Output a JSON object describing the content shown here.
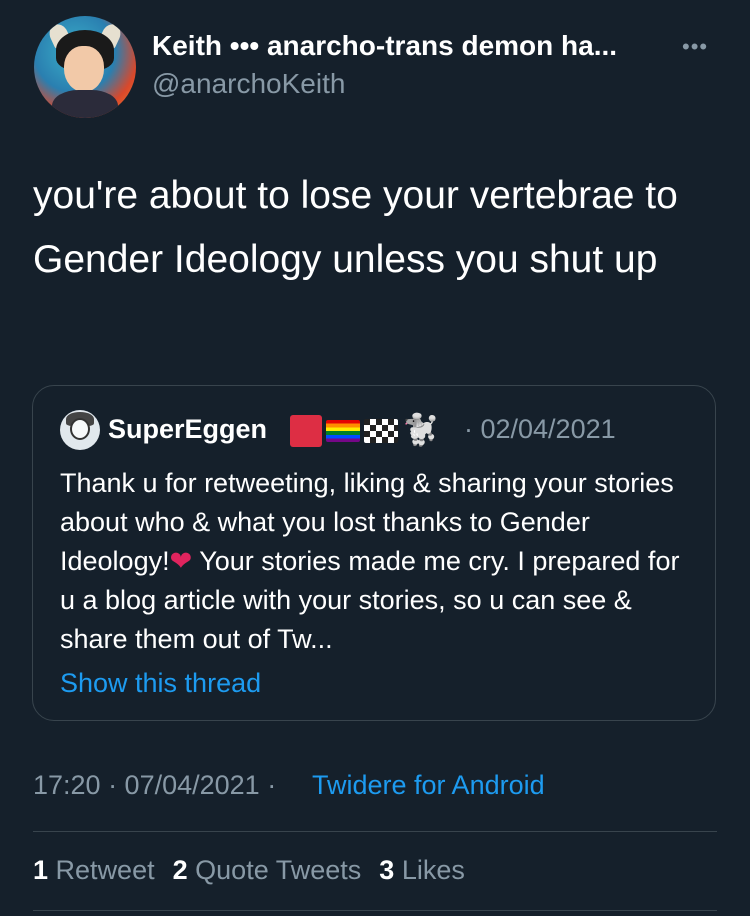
{
  "author": {
    "display_name": "Keith ••• anarcho-trans demon ha...",
    "handle": "@anarchoKeith",
    "avatar_icon": "cartoon-demon-avatar"
  },
  "more_icon": "•••",
  "tweet": {
    "text": "you're about to lose your vertebrae to Gender Ideology unless you shut up"
  },
  "quote": {
    "author_name": "SuperEggen",
    "flags": [
      "red-square",
      "rainbow-flag",
      "checkered-flag",
      "poodle"
    ],
    "poodle_glyph": "🐩",
    "date": "· 02/04/2021",
    "text_before_heart": "Thank u for retweeting, liking & sharing your stories about who & what you lost thanks to Gender Ideology!",
    "heart": "❤",
    "text_after_heart": " Your stories made me cry. I prepared for u a blog article with your stories, so u can see & share them out of Tw...",
    "show_thread": "Show this thread"
  },
  "meta": {
    "timestamp": "17:20 · 07/04/2021 ·",
    "client": "Twidere for Android"
  },
  "stats": {
    "retweets_count": "1",
    "retweets_label": "Retweet",
    "quotes_count": "2",
    "quotes_label": "Quote Tweets",
    "likes_count": "3",
    "likes_label": "Likes"
  },
  "colors": {
    "background": "#15202b",
    "muted": "#8899a6",
    "link": "#1d9bf0",
    "border": "#38444d"
  }
}
